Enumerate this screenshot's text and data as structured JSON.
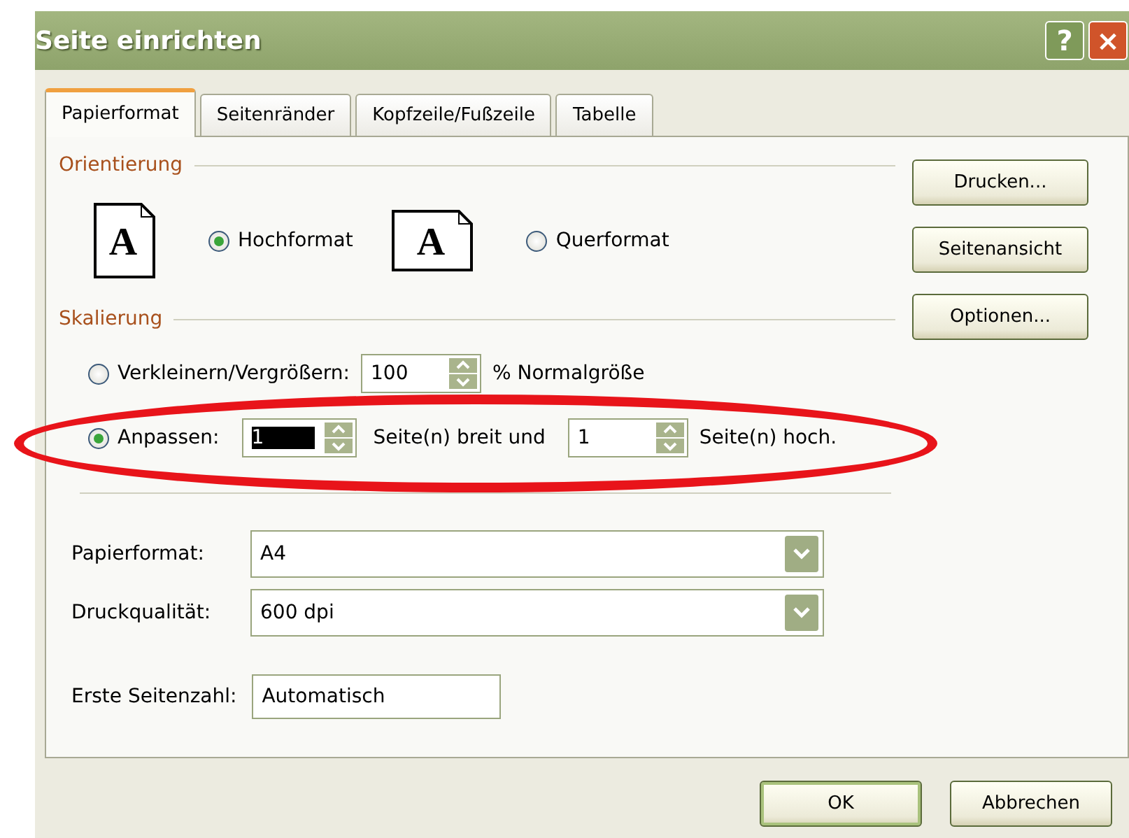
{
  "window": {
    "title": "Seite einrichten",
    "controls": [
      "?",
      "×"
    ]
  },
  "tabs": [
    {
      "label": "Papierformat",
      "selected": true
    },
    {
      "label": "Seitenränder",
      "selected": false
    },
    {
      "label": "Kopfzeile/Fußzeile",
      "selected": false
    },
    {
      "label": "Tabelle",
      "selected": false
    }
  ],
  "orientation": {
    "label": "Orientierung",
    "options": [
      {
        "label": "Hochformat",
        "selected": true,
        "icon_letter": "A",
        "kind": "portrait"
      },
      {
        "label": "Querformat",
        "selected": false,
        "icon_letter": "A",
        "kind": "landscape"
      }
    ]
  },
  "scaling": {
    "label": "Skalierung",
    "zoom": {
      "label": "Verkleinern/Vergrößern:",
      "selected": false,
      "value": "100",
      "suffix": "% Normalgröße"
    },
    "fit": {
      "label": "Anpassen:",
      "selected": true,
      "wide_value": "1",
      "wide_suffix": "Seite(n) breit und",
      "tall_value": "1",
      "tall_suffix": "Seite(n) hoch."
    }
  },
  "fields": [
    {
      "kind": "combo",
      "label": "Papierformat:",
      "value": "A4"
    },
    {
      "kind": "combo",
      "label": "Druckqualität:",
      "value": "600 dpi"
    },
    {
      "kind": "text",
      "label": "Erste Seitenzahl:",
      "value": "Automatisch"
    }
  ],
  "side_buttons": [
    "Drucken...",
    "Seitenansicht",
    "Optionen..."
  ],
  "buttons": [
    {
      "label": "OK",
      "default": true
    },
    {
      "label": "Abbrechen",
      "default": false
    }
  ]
}
